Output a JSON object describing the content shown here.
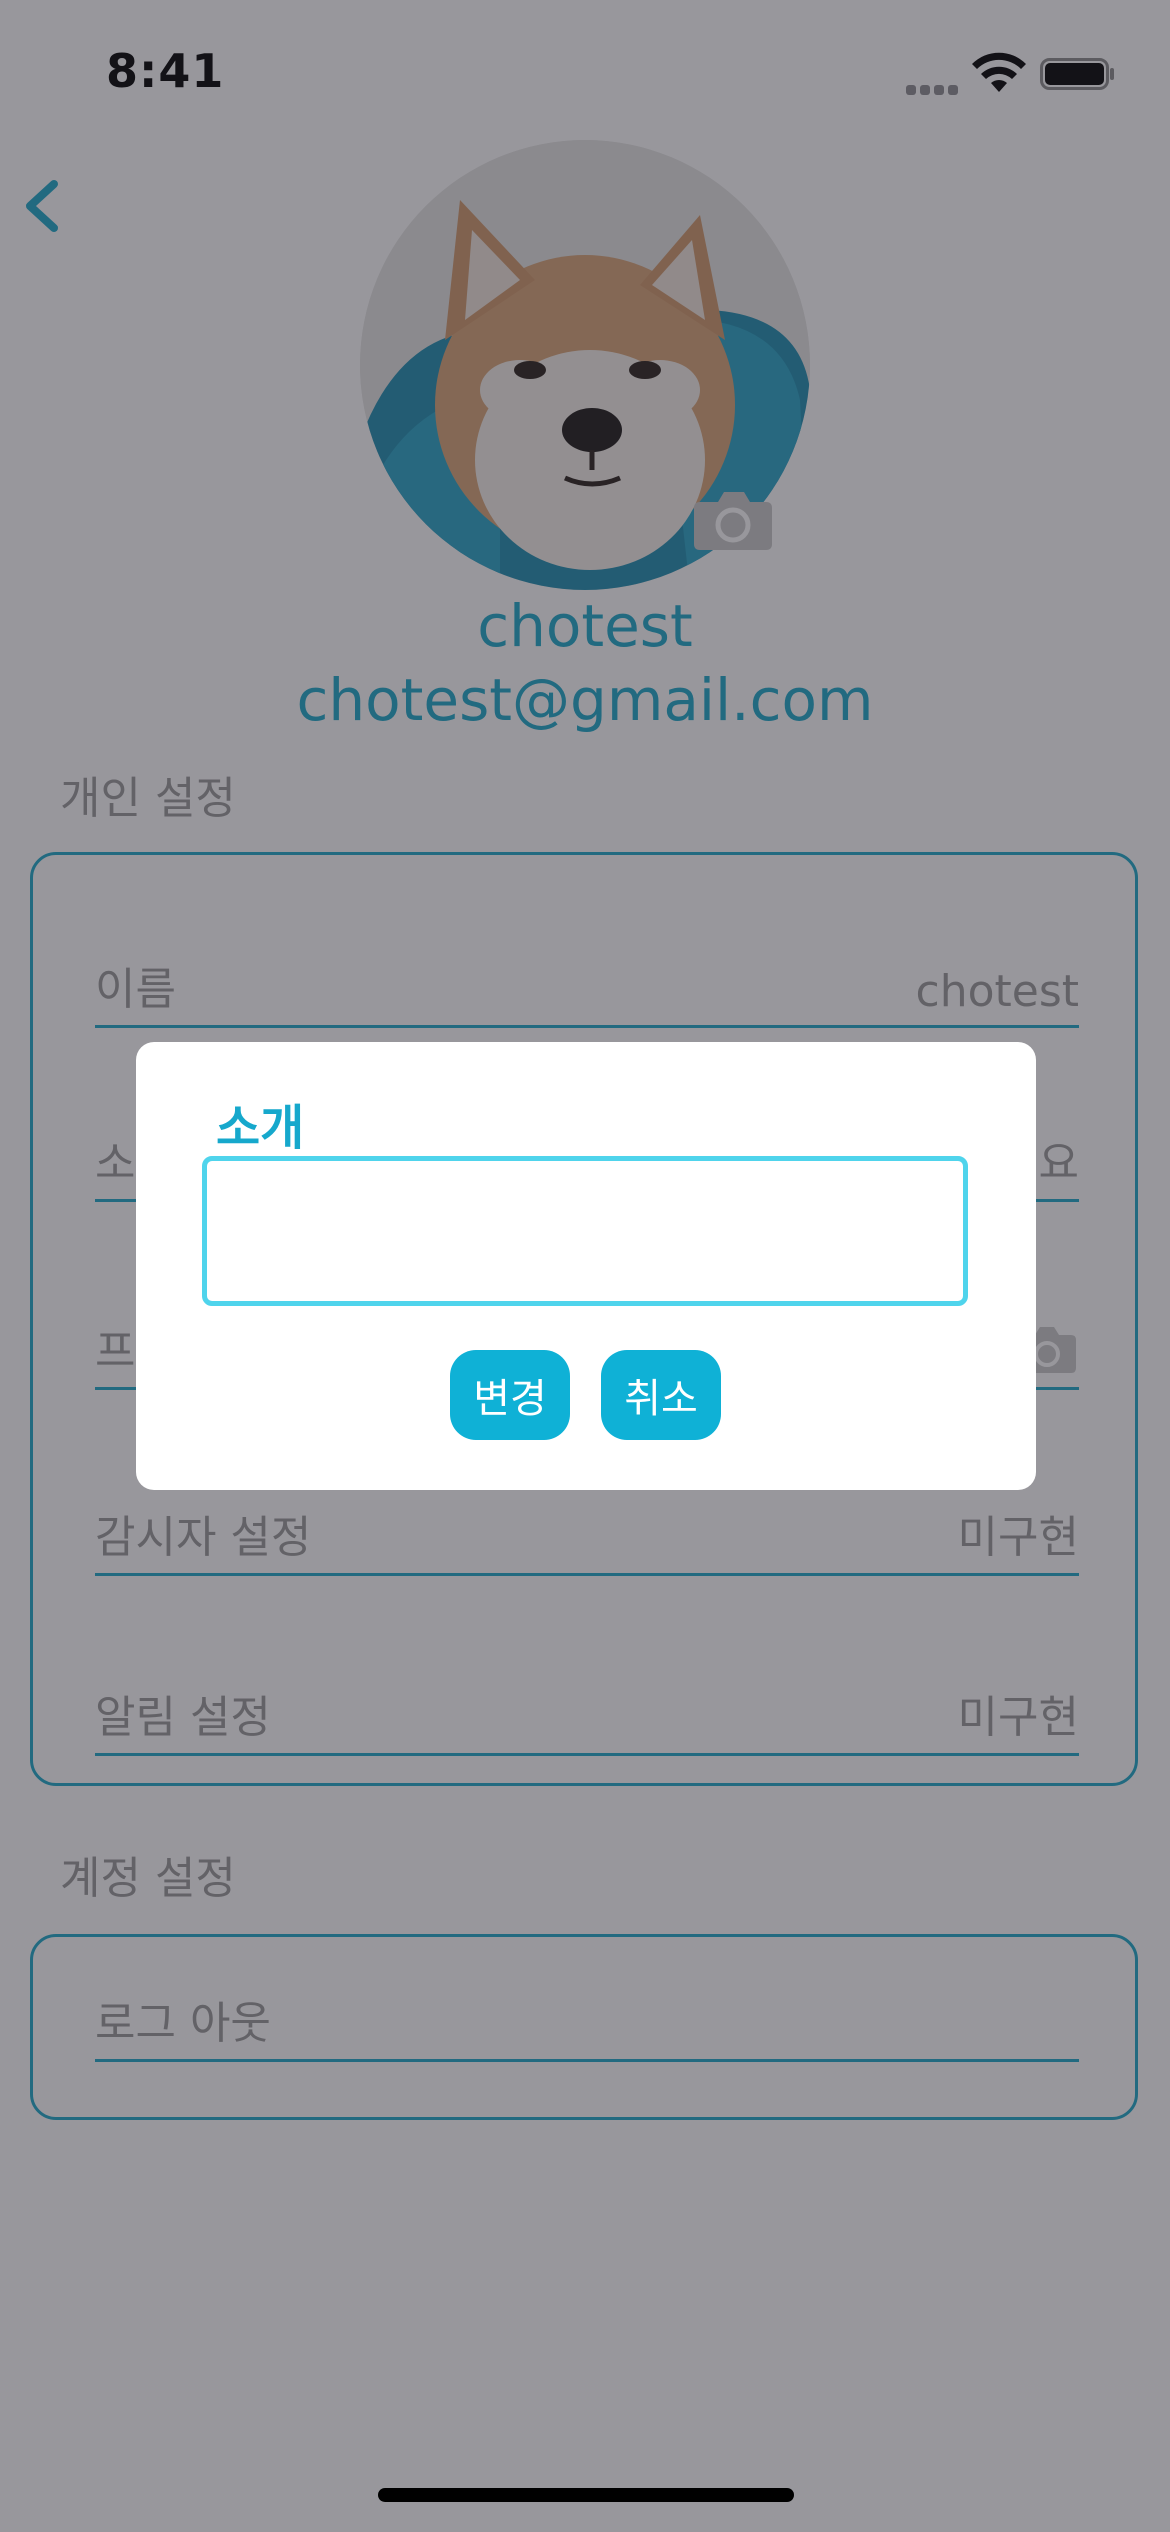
{
  "status_bar": {
    "time": "8:41"
  },
  "profile": {
    "name": "chotest",
    "email": "chotest@gmail.com"
  },
  "personal_section": {
    "title": "개인 설정",
    "rows": [
      {
        "label": "이름",
        "value": "chotest"
      },
      {
        "label": "소",
        "value": "요"
      },
      {
        "label": "프",
        "value": ""
      },
      {
        "label": "감시자 설정",
        "value": "미구현"
      },
      {
        "label": "알림 설정",
        "value": "미구현"
      }
    ]
  },
  "account_section": {
    "title": "계정 설정",
    "rows": [
      {
        "label": "로그 아웃"
      }
    ]
  },
  "dialog": {
    "title": "소개",
    "input_value": "",
    "change_label": "변경",
    "cancel_label": "취소"
  },
  "colors": {
    "accent": "#1EA9C9",
    "dialog_button": "#0FB1D6",
    "input_border": "#4FD4EC",
    "muted_text": "#9A9A9A",
    "overlay": "rgba(40,38,48,0.48)"
  },
  "icons": {
    "back": "chevron-left-icon",
    "camera": "camera-icon",
    "wifi": "wifi-icon",
    "battery": "battery-icon",
    "signal": "cellular-signal-icon"
  }
}
